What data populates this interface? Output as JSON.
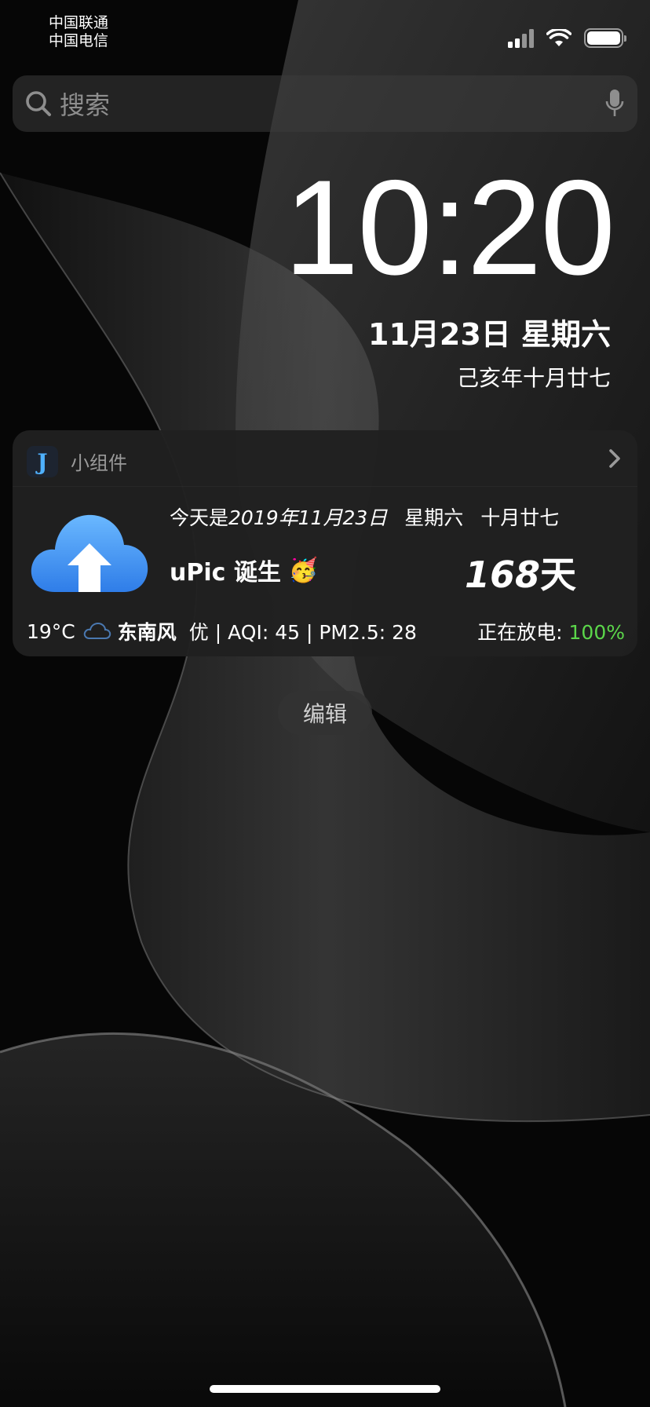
{
  "status_bar": {
    "carrier_1": "中国联通",
    "carrier_2": "中国电信",
    "icons": [
      "cellular-signal-icon",
      "wifi-icon",
      "battery-icon"
    ]
  },
  "search": {
    "placeholder": "搜索",
    "icons": [
      "search-icon",
      "microphone-icon"
    ]
  },
  "clock": {
    "time": "10:20",
    "date": "11月23日 星期六",
    "lunar_date": "己亥年十月廿七"
  },
  "widget": {
    "app_icon_letter": "J",
    "title": "小组件",
    "today_prefix": "今天是",
    "today_date": "2019年11月23日",
    "weekday": "星期六",
    "lunar": "十月廿七",
    "event": "uPic 诞生",
    "event_emoji": "🥳",
    "days_number": "168",
    "days_unit": "天",
    "temperature": "19°C",
    "wind": "东南风",
    "air_quality": "优 | AQI: 45 | PM2.5: 28",
    "battery_label": "正在放电: ",
    "battery_value": "100%"
  },
  "edit_button": {
    "label": "编辑"
  },
  "colors": {
    "battery_green": "#5bd64a",
    "widget_bg": "#202020",
    "upic_blue": "#4a90f0"
  }
}
